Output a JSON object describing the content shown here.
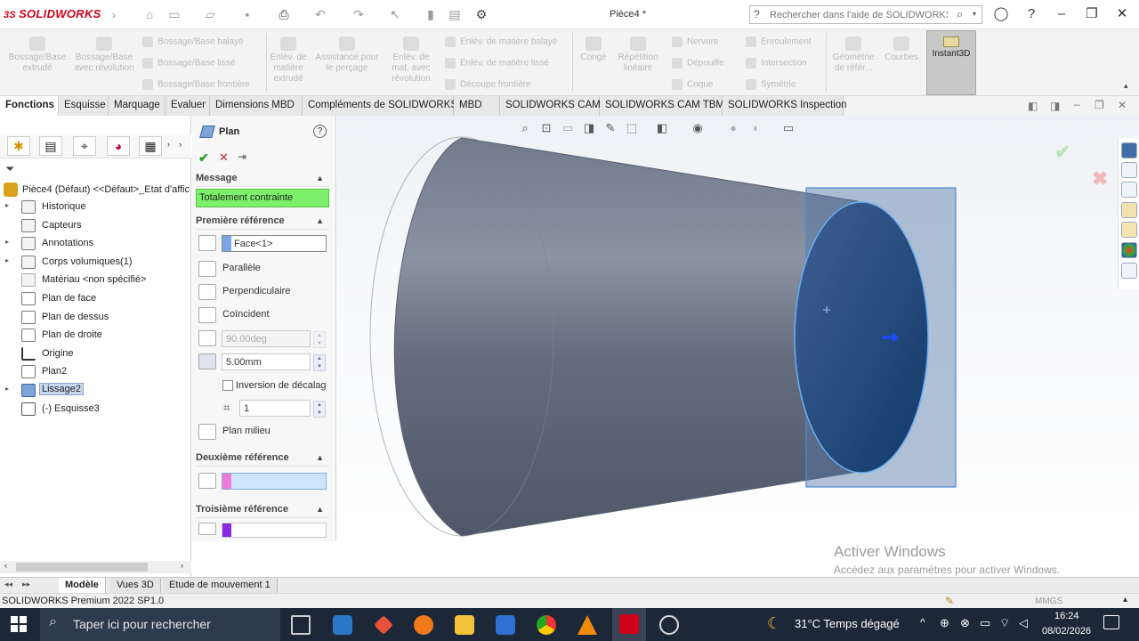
{
  "titlebar": {
    "brand": "SOLIDWORKS",
    "doc_title": "Pièce4 *",
    "help_search_placeholder": "Rechercher dans l'aide de SOLIDWORKS"
  },
  "commands": {
    "extrude": "Bossage/Base extrudé",
    "revolve": "Bossage/Base avec révolution",
    "swept": "Bossage/Base balayé",
    "loft": "Bossage/Base lissé",
    "boundary": "Bossage/Base frontière",
    "cut_extrude": "Enlèv. de matière extrudé",
    "hole_wizard": "Assistance pour le perçage",
    "cut_revolve": "Enlèv. de mat. avec révolution",
    "cut_swept": "Enlév. de matière balayé",
    "cut_loft": "Enlév. de matière lissé",
    "cut_boundary": "Découpe frontière",
    "fillet": "Congé",
    "linear_pattern": "Répétition linéaire",
    "rib": "Nervure",
    "draft": "Dépouille",
    "shell": "Coque",
    "wrap": "Enroulement",
    "intersect": "Intersection",
    "mirror": "Symétrie",
    "ref_geometry": "Géométrie de référ...",
    "curves": "Courbes",
    "instant3d": "Instant3D"
  },
  "tabs": [
    "Fonctions",
    "Esquisse",
    "Marquage",
    "Evaluer",
    "Dimensions MBD",
    "Compléments de SOLIDWORKS",
    "MBD",
    "SOLIDWORKS CAM",
    "SOLIDWORKS CAM TBM",
    "SOLIDWORKS Inspection"
  ],
  "tree": {
    "root": "Pièce4 (Défaut) <<Défaut>_Etat d'affic",
    "items": [
      {
        "label": "Historique"
      },
      {
        "label": "Capteurs"
      },
      {
        "label": "Annotations"
      },
      {
        "label": "Corps volumiques(1)"
      },
      {
        "label": "Matériau <non spécifié>"
      },
      {
        "label": "Plan de face"
      },
      {
        "label": "Plan de dessus"
      },
      {
        "label": "Plan de droite"
      },
      {
        "label": "Origine"
      },
      {
        "label": "Plan2"
      },
      {
        "label": "Lissage2"
      },
      {
        "label": "(-) Esquisse3"
      }
    ]
  },
  "pm": {
    "title": "Plan",
    "message_header": "Message",
    "message": "Totalement contrainte",
    "first_ref_header": "Première référence",
    "first_ref_value": "Face<1>",
    "parallel": "Parallèle",
    "perpendicular": "Perpendiculaire",
    "coincident": "Coïncident",
    "angle_value": "90.00deg",
    "offset_value": "5.00mm",
    "flip_offset": "Inversion de décalag",
    "count_value": "1",
    "mid_plane": "Plan milieu",
    "second_ref_header": "Deuxième référence",
    "third_ref_header": "Troisième référence"
  },
  "bottom_tabs": [
    "Modèle",
    "Vues 3D",
    "Etude de mouvement 1"
  ],
  "status": {
    "version": "SOLIDWORKS Premium 2022 SP1.0",
    "units": "MMGS"
  },
  "watermark": {
    "line1": "Activer Windows",
    "line2": "Accédez aux paramètres pour activer Windows."
  },
  "taskbar": {
    "search_placeholder": "Taper ici pour rechercher",
    "weather": "31°C  Temps dégagé",
    "time": "16:24",
    "date": "08/02/2026"
  },
  "colors": {
    "accent_green": "#7cf06a",
    "ref2_pink": "#f07ad8",
    "ref3_purple": "#8a2be2",
    "brand_red": "#d0021b"
  }
}
